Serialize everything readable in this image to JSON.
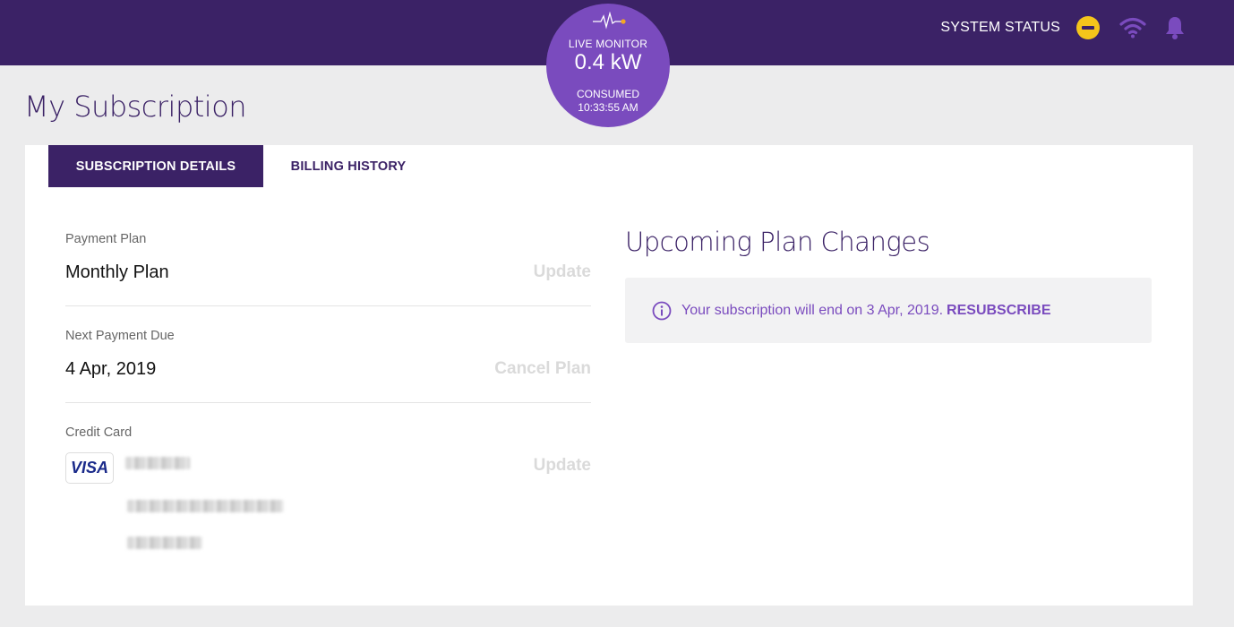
{
  "header": {
    "system_status_label": "SYSTEM STATUS",
    "status_color": "#f5c51b",
    "brand_color": "#3b2266",
    "accent_color": "#7a4bbe"
  },
  "monitor": {
    "label": "LIVE MONITOR",
    "value": "0.4 kW",
    "consumed_label": "CONSUMED",
    "time": "10:33:55 AM"
  },
  "page": {
    "title": "My Subscription"
  },
  "tabs": [
    {
      "label": "SUBSCRIPTION DETAILS",
      "active": true
    },
    {
      "label": "BILLING HISTORY",
      "active": false
    }
  ],
  "details": {
    "payment_plan": {
      "label": "Payment Plan",
      "value": "Monthly Plan",
      "action": "Update"
    },
    "next_payment": {
      "label": "Next Payment Due",
      "value": "4 Apr, 2019",
      "action": "Cancel Plan"
    },
    "credit_card": {
      "label": "Credit Card",
      "brand": "VISA",
      "action": "Update"
    }
  },
  "upcoming": {
    "title": "Upcoming Plan Changes",
    "notice_text": "Your subscription will end on 3 Apr, 2019.",
    "resubscribe_label": "RESUBSCRIBE"
  }
}
